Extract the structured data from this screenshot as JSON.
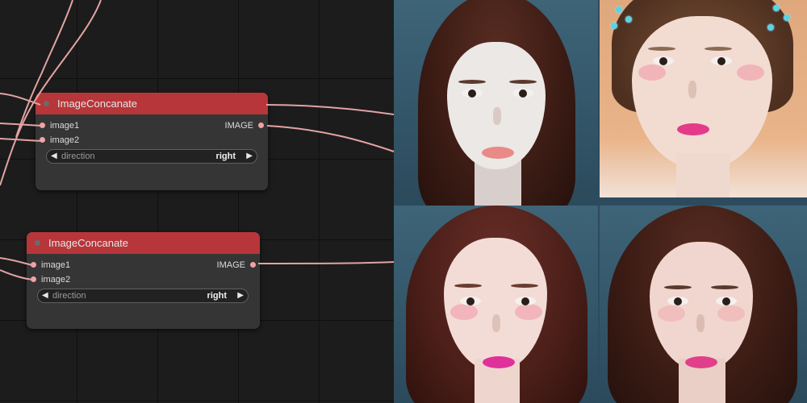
{
  "nodes": [
    {
      "title": "ImageConcanate",
      "inputs": [
        "image1",
        "image2"
      ],
      "output": "IMAGE",
      "widget": {
        "name": "direction",
        "value": "right"
      }
    },
    {
      "title": "ImageConcanate",
      "inputs": [
        "image1",
        "image2"
      ],
      "output": "IMAGE",
      "widget": {
        "name": "direction",
        "value": "right"
      }
    }
  ],
  "preview": {
    "description_icons": [
      "left-arrow-icon",
      "right-arrow-icon"
    ],
    "accent_colors": {
      "header": "#b7363a",
      "wire": "#f0a3a3",
      "node_body": "#353535"
    }
  }
}
